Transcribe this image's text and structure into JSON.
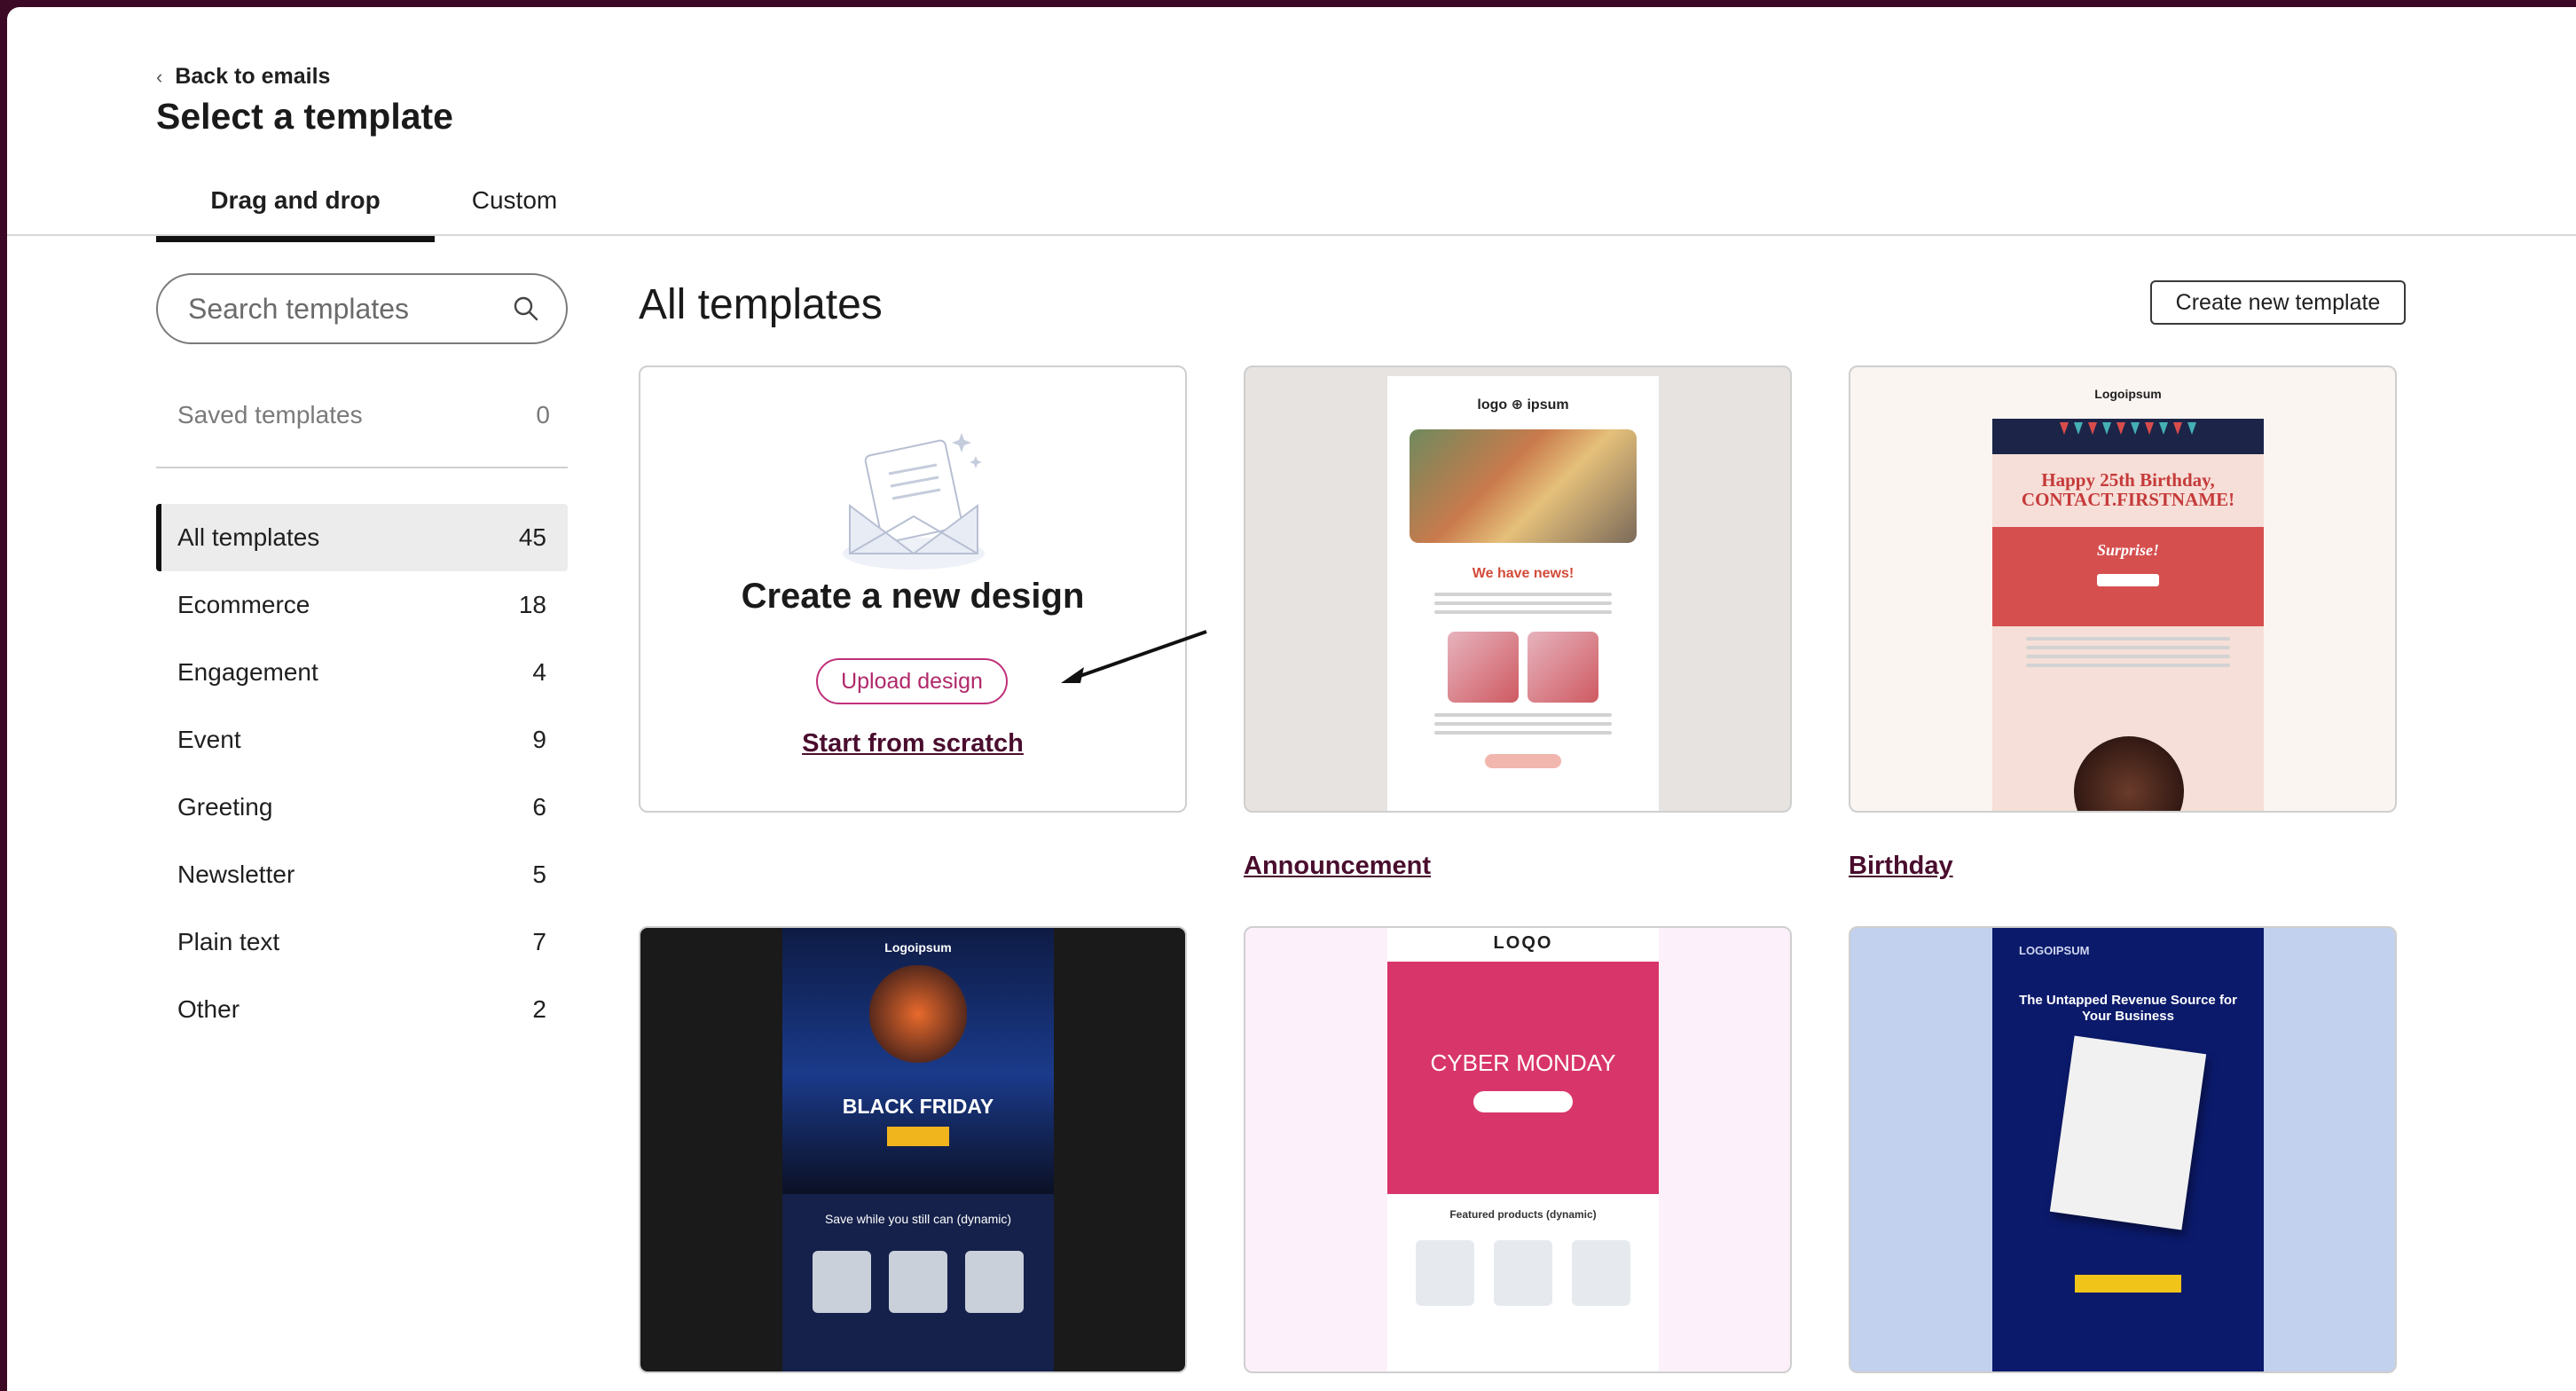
{
  "header": {
    "back_label": "Back to emails",
    "title": "Select a template"
  },
  "tabs": [
    {
      "label": "Drag and drop",
      "active": true
    },
    {
      "label": "Custom",
      "active": false
    }
  ],
  "sidebar": {
    "search_placeholder": "Search templates",
    "saved": {
      "label": "Saved templates",
      "count": "0"
    },
    "categories": [
      {
        "label": "All templates",
        "count": "45",
        "active": true
      },
      {
        "label": "Ecommerce",
        "count": "18"
      },
      {
        "label": "Engagement",
        "count": "4"
      },
      {
        "label": "Event",
        "count": "9"
      },
      {
        "label": "Greeting",
        "count": "6"
      },
      {
        "label": "Newsletter",
        "count": "5"
      },
      {
        "label": "Plain text",
        "count": "7"
      },
      {
        "label": "Other",
        "count": "2"
      }
    ]
  },
  "main": {
    "title": "All templates",
    "create_button": "Create new template",
    "create_card": {
      "title": "Create a new design",
      "upload_label": "Upload design",
      "scratch_label": "Start from scratch"
    },
    "cards": [
      {
        "label": "Announcement",
        "preview": {
          "logo": "logo ⊕ ipsum",
          "headline": "We have news!"
        }
      },
      {
        "label": "Birthday",
        "preview": {
          "logo": "Logoipsum",
          "headline": "Happy 25th Birthday, CONTACT.FIRSTNAME!",
          "surprise": "Surprise!"
        }
      },
      {
        "label": "",
        "preview": {
          "logo": "Logoipsum",
          "headline": "BLACK FRIDAY",
          "sub": "Save while you still can (dynamic)"
        }
      },
      {
        "label": "",
        "preview": {
          "logo": "LOQO",
          "headline": "CYBER MONDAY",
          "sub": "Featured products (dynamic)"
        }
      },
      {
        "label": "",
        "preview": {
          "logo": "LOGOIPSUM",
          "headline": "The Untapped Revenue Source for Your Business"
        }
      }
    ]
  },
  "colors": {
    "brand_dark": "#3d0a26",
    "link": "#4a0d2e",
    "upload_accent": "#c0307a"
  }
}
